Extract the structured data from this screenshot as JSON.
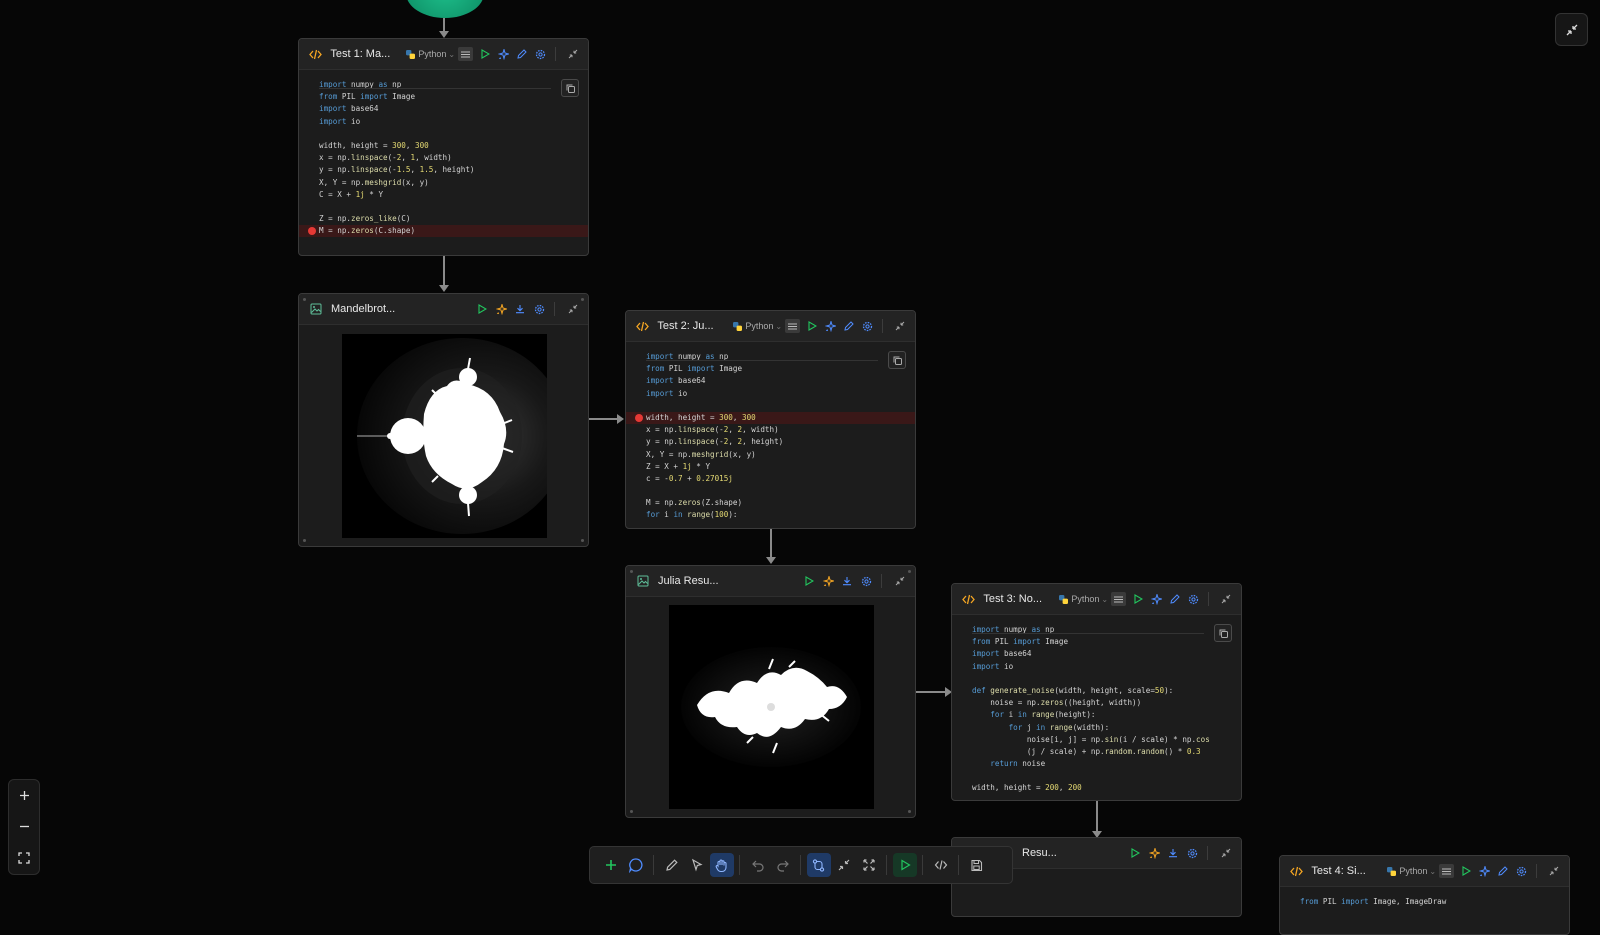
{
  "colors": {
    "accent_blue": "#4f8cff",
    "run_green": "#22c55e",
    "ai_orange": "#f5a623",
    "start_node_green": "#13a878",
    "breakpoint_red": "#e53935",
    "canvas_bg": "#060606"
  },
  "nodes": [
    {
      "id": "test1",
      "kind": "code",
      "title": "Test 1: Ma...",
      "language": "Python",
      "breakpoint_line": 12,
      "lines": [
        "import numpy as np",
        "from PIL import Image",
        "import base64",
        "import io",
        "",
        "width, height = 300, 300",
        "x = np.linspace(-2, 1, width)",
        "y = np.linspace(-1.5, 1.5, height)",
        "X, Y = np.meshgrid(x, y)",
        "C = X + 1j * Y",
        "",
        "Z = np.zeros_like(C)",
        "M = np.zeros(C.shape)"
      ]
    },
    {
      "id": "mandel",
      "kind": "image",
      "title": "Mandelbrot..."
    },
    {
      "id": "test2",
      "kind": "code",
      "title": "Test 2: Ju...",
      "language": "Python",
      "breakpoint_line": 5,
      "lines": [
        "import numpy as np",
        "from PIL import Image",
        "import base64",
        "import io",
        "",
        "width, height = 300, 300",
        "x = np.linspace(-2, 2, width)",
        "y = np.linspace(-2, 2, height)",
        "X, Y = np.meshgrid(x, y)",
        "Z = X + 1j * Y",
        "c = -0.7 + 0.27015j",
        "",
        "M = np.zeros(Z.shape)",
        "for i in range(100):"
      ]
    },
    {
      "id": "julia",
      "kind": "image",
      "title": "Julia Resu..."
    },
    {
      "id": "test3",
      "kind": "code",
      "title": "Test 3: No...",
      "language": "Python",
      "breakpoint_line": -1,
      "lines": [
        "import numpy as np",
        "from PIL import Image",
        "import base64",
        "import io",
        "",
        "def generate_noise(width, height, scale=50):",
        "    noise = np.zeros((height, width))",
        "    for i in range(height):",
        "        for j in range(width):",
        "            noise[i, j] = np.sin(i / scale) * np.cos",
        "            (j / scale) + np.random.random() * 0.3",
        "    return noise",
        "",
        "width, height = 200, 200"
      ]
    },
    {
      "id": "noise",
      "kind": "image",
      "title": "Resu..."
    },
    {
      "id": "test4",
      "kind": "code",
      "title": "Test 4: Si...",
      "language": "Python",
      "breakpoint_line": -1,
      "lines": [
        "from PIL import Image, ImageDraw"
      ]
    }
  ],
  "toolbar": {
    "items": [
      "add-node",
      "comment",
      "draw",
      "select",
      "pan",
      "undo",
      "redo",
      "connect",
      "collapse",
      "expand",
      "run-all",
      "code-view",
      "save"
    ],
    "active": [
      "pan",
      "connect"
    ]
  },
  "zoom": {
    "controls": [
      "zoom-in",
      "zoom-out",
      "fit-view"
    ]
  }
}
